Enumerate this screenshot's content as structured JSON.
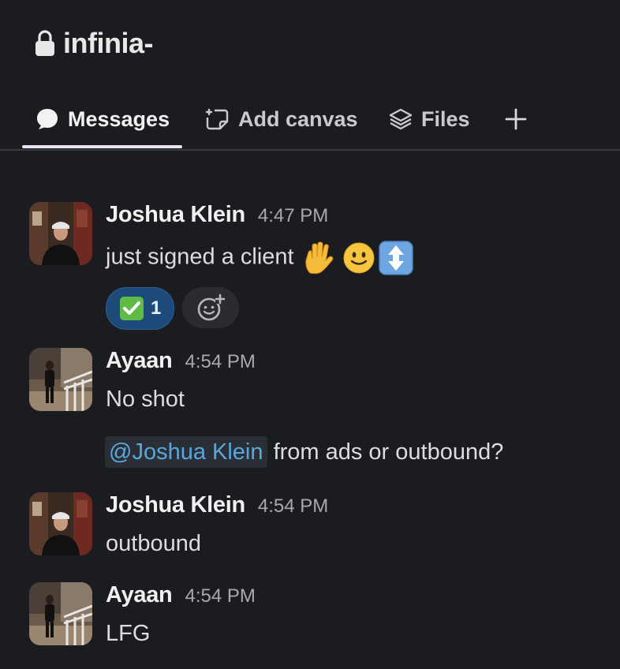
{
  "channel": {
    "title": "infinia-",
    "icon": "lock-icon"
  },
  "tabs": [
    {
      "label": "Messages",
      "icon": "chat-bubble-icon",
      "active": true
    },
    {
      "label": "Add canvas",
      "icon": "canvas-add-icon"
    },
    {
      "label": "Files",
      "icon": "layers-icon"
    },
    {
      "label": "+",
      "icon": "plus-icon"
    }
  ],
  "messages": [
    {
      "author": "Joshua Klein",
      "time": "4:47 PM",
      "text": "just signed a client",
      "emojis": [
        "raised-hand-emoji",
        "slightly-smiling-face-emoji",
        "up-down-arrow-emoji"
      ],
      "reactions": [
        {
          "emoji": "check-mark-button-emoji",
          "count": "1"
        }
      ]
    },
    {
      "author": "Ayaan",
      "time": "4:54 PM",
      "text": "No shot",
      "followup_mention": "@Joshua Klein",
      "followup_text": "from ads or outbound?"
    },
    {
      "author": "Joshua Klein",
      "time": "4:54 PM",
      "text": "outbound"
    },
    {
      "author": "Ayaan",
      "time": "4:54 PM",
      "text": "LFG"
    }
  ],
  "colors": {
    "background": "#1b1c20",
    "reaction_active": "#1e4a7a",
    "mention": "#5aa7dd",
    "tab_underline": "#e8e1f0"
  }
}
